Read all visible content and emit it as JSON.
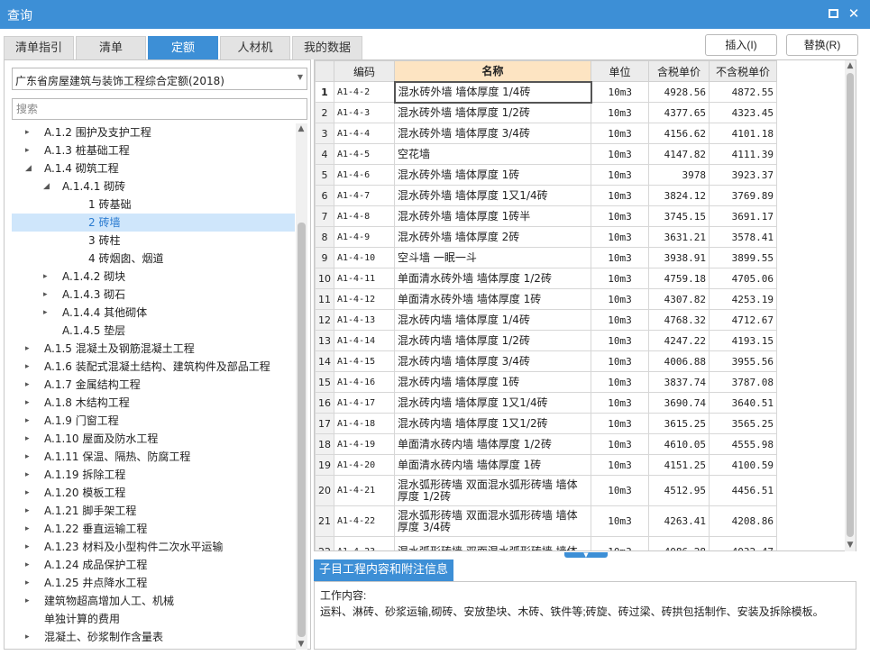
{
  "window": {
    "title": "查询"
  },
  "tabs": [
    "清单指引",
    "清单",
    "定额",
    "人材机",
    "我的数据"
  ],
  "active_tab": 2,
  "buttons": {
    "insert": "插入(I)",
    "replace": "替换(R)"
  },
  "left": {
    "dropdown_value": "广东省房屋建筑与装饰工程综合定额(2018)",
    "search_placeholder": "搜索",
    "tree": [
      {
        "label": "A.1.2 围护及支护工程",
        "arrow": "▸",
        "level": 0
      },
      {
        "label": "A.1.3 桩基础工程",
        "arrow": "▸",
        "level": 0
      },
      {
        "label": "A.1.4 砌筑工程",
        "arrow": "◢",
        "level": 0
      },
      {
        "label": "A.1.4.1 砌砖",
        "arrow": "◢",
        "level": 1
      },
      {
        "label": "1 砖基础",
        "arrow": "",
        "level": 2
      },
      {
        "label": "2 砖墙",
        "arrow": "",
        "level": 2,
        "selected": true
      },
      {
        "label": "3 砖柱",
        "arrow": "",
        "level": 2
      },
      {
        "label": "4 砖烟囱、烟道",
        "arrow": "",
        "level": 2
      },
      {
        "label": "A.1.4.2 砌块",
        "arrow": "▸",
        "level": 1
      },
      {
        "label": "A.1.4.3 砌石",
        "arrow": "▸",
        "level": 1
      },
      {
        "label": "A.1.4.4 其他砌体",
        "arrow": "▸",
        "level": 1
      },
      {
        "label": "A.1.4.5 垫层",
        "arrow": "",
        "level": 1
      },
      {
        "label": "A.1.5 混凝土及钢筋混凝土工程",
        "arrow": "▸",
        "level": 0
      },
      {
        "label": "A.1.6 装配式混凝土结构、建筑构件及部品工程",
        "arrow": "▸",
        "level": 0
      },
      {
        "label": "A.1.7 金属结构工程",
        "arrow": "▸",
        "level": 0
      },
      {
        "label": "A.1.8 木结构工程",
        "arrow": "▸",
        "level": 0
      },
      {
        "label": "A.1.9 门窗工程",
        "arrow": "▸",
        "level": 0
      },
      {
        "label": "A.1.10 屋面及防水工程",
        "arrow": "▸",
        "level": 0
      },
      {
        "label": "A.1.11 保温、隔热、防腐工程",
        "arrow": "▸",
        "level": 0
      },
      {
        "label": "A.1.19 拆除工程",
        "arrow": "▸",
        "level": 0
      },
      {
        "label": "A.1.20 模板工程",
        "arrow": "▸",
        "level": 0
      },
      {
        "label": "A.1.21 脚手架工程",
        "arrow": "▸",
        "level": 0
      },
      {
        "label": "A.1.22 垂直运输工程",
        "arrow": "▸",
        "level": 0
      },
      {
        "label": "A.1.23 材料及小型构件二次水平运输",
        "arrow": "▸",
        "level": 0
      },
      {
        "label": "A.1.24 成品保护工程",
        "arrow": "▸",
        "level": 0
      },
      {
        "label": "A.1.25 井点降水工程",
        "arrow": "▸",
        "level": 0
      },
      {
        "label": "建筑物超高增加人工、机械",
        "arrow": "▸",
        "level": 0
      },
      {
        "label": "单独计算的费用",
        "arrow": "",
        "level": 0
      },
      {
        "label": "混凝土、砂浆制作含量表",
        "arrow": "▸",
        "level": 0
      }
    ]
  },
  "table": {
    "headers": [
      "编码",
      "名称",
      "单位",
      "含税单价",
      "不含税单价"
    ],
    "rows": [
      {
        "n": "1",
        "code": "A1-4-2",
        "name": "混水砖外墙 墙体厚度 1/4砖",
        "unit": "10m3",
        "tax": "4928.56",
        "notax": "4872.55"
      },
      {
        "n": "2",
        "code": "A1-4-3",
        "name": "混水砖外墙 墙体厚度 1/2砖",
        "unit": "10m3",
        "tax": "4377.65",
        "notax": "4323.45"
      },
      {
        "n": "3",
        "code": "A1-4-4",
        "name": "混水砖外墙 墙体厚度 3/4砖",
        "unit": "10m3",
        "tax": "4156.62",
        "notax": "4101.18"
      },
      {
        "n": "4",
        "code": "A1-4-5",
        "name": "空花墙",
        "unit": "10m3",
        "tax": "4147.82",
        "notax": "4111.39"
      },
      {
        "n": "5",
        "code": "A1-4-6",
        "name": "混水砖外墙 墙体厚度 1砖",
        "unit": "10m3",
        "tax": "3978",
        "notax": "3923.37"
      },
      {
        "n": "6",
        "code": "A1-4-7",
        "name": "混水砖外墙 墙体厚度 1又1/4砖",
        "unit": "10m3",
        "tax": "3824.12",
        "notax": "3769.89"
      },
      {
        "n": "7",
        "code": "A1-4-8",
        "name": "混水砖外墙 墙体厚度 1砖半",
        "unit": "10m3",
        "tax": "3745.15",
        "notax": "3691.17"
      },
      {
        "n": "8",
        "code": "A1-4-9",
        "name": "混水砖外墙 墙体厚度 2砖",
        "unit": "10m3",
        "tax": "3631.21",
        "notax": "3578.41"
      },
      {
        "n": "9",
        "code": "A1-4-10",
        "name": "空斗墙 一眠一斗",
        "unit": "10m3",
        "tax": "3938.91",
        "notax": "3899.55"
      },
      {
        "n": "10",
        "code": "A1-4-11",
        "name": "单面清水砖外墙 墙体厚度 1/2砖",
        "unit": "10m3",
        "tax": "4759.18",
        "notax": "4705.06"
      },
      {
        "n": "11",
        "code": "A1-4-12",
        "name": "单面清水砖外墙 墙体厚度 1砖",
        "unit": "10m3",
        "tax": "4307.82",
        "notax": "4253.19"
      },
      {
        "n": "12",
        "code": "A1-4-13",
        "name": "混水砖内墙 墙体厚度 1/4砖",
        "unit": "10m3",
        "tax": "4768.32",
        "notax": "4712.67"
      },
      {
        "n": "13",
        "code": "A1-4-14",
        "name": "混水砖内墙 墙体厚度 1/2砖",
        "unit": "10m3",
        "tax": "4247.22",
        "notax": "4193.15"
      },
      {
        "n": "14",
        "code": "A1-4-15",
        "name": "混水砖内墙 墙体厚度 3/4砖",
        "unit": "10m3",
        "tax": "4006.88",
        "notax": "3955.56"
      },
      {
        "n": "15",
        "code": "A1-4-16",
        "name": "混水砖内墙 墙体厚度 1砖",
        "unit": "10m3",
        "tax": "3837.74",
        "notax": "3787.08"
      },
      {
        "n": "16",
        "code": "A1-4-17",
        "name": "混水砖内墙 墙体厚度 1又1/4砖",
        "unit": "10m3",
        "tax": "3690.74",
        "notax": "3640.51"
      },
      {
        "n": "17",
        "code": "A1-4-18",
        "name": "混水砖内墙 墙体厚度 1又1/2砖",
        "unit": "10m3",
        "tax": "3615.25",
        "notax": "3565.25"
      },
      {
        "n": "18",
        "code": "A1-4-19",
        "name": "单面清水砖内墙 墙体厚度 1/2砖",
        "unit": "10m3",
        "tax": "4610.05",
        "notax": "4555.98"
      },
      {
        "n": "19",
        "code": "A1-4-20",
        "name": "单面清水砖内墙 墙体厚度 1砖",
        "unit": "10m3",
        "tax": "4151.25",
        "notax": "4100.59"
      },
      {
        "n": "20",
        "code": "A1-4-21",
        "name": "混水弧形砖墙 双面混水弧形砖墙 墙体厚度 1/2砖",
        "unit": "10m3",
        "tax": "4512.95",
        "notax": "4456.51"
      },
      {
        "n": "21",
        "code": "A1-4-22",
        "name": "混水弧形砖墙 双面混水弧形砖墙 墙体厚度 3/4砖",
        "unit": "10m3",
        "tax": "4263.41",
        "notax": "4208.86"
      },
      {
        "n": "22",
        "code": "A1-4-23",
        "name": "混水弧形砖墙 双面混水弧形砖墙 墙体",
        "unit": "10m3",
        "tax": "4086.28",
        "notax": "4032.47"
      }
    ]
  },
  "bottom": {
    "tab": "子目工程内容和附注信息",
    "line1": "工作内容:",
    "line2": "运料、淋砖、砂浆运输,砌砖、安放垫块、木砖、铁件等;砖旋、砖过梁、砖拱包括制作、安装及拆除模板。"
  },
  "colors": {
    "accent": "#3d8fd6",
    "header_highlight": "#fde4c2",
    "selected_row": "#cfe6fb"
  }
}
